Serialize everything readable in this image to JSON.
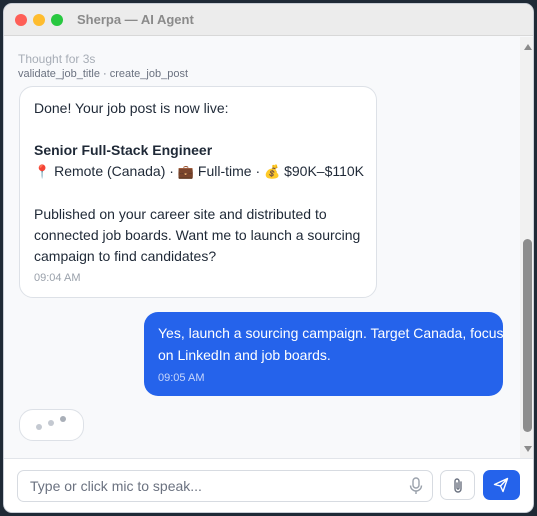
{
  "window": {
    "title": "Sherpa — AI Agent"
  },
  "chat": {
    "thought": "Thought for 3s",
    "tools": "validate_job_title · create_job_post",
    "agent_message": {
      "intro": "Done! Your job post is now live:",
      "job_title": "Senior Full-Stack Engineer",
      "meta": {
        "location_icon": "📍",
        "location": "Remote (Canada)",
        "type_icon": "💼",
        "type": "Full-time",
        "salary_icon": "💰",
        "salary": "$90K–$110K",
        "separator": "·"
      },
      "body_lines": [
        "Published on your career site and distributed to",
        "connected job boards. Want me to launch a sourcing",
        "campaign to find candidates?"
      ],
      "time": "09:04 AM"
    },
    "user_message": {
      "lines": [
        "Yes, launch a sourcing campaign. Target Canada, focus",
        "on LinkedIn and job boards."
      ],
      "time": "09:05 AM"
    }
  },
  "composer": {
    "placeholder": "Type or click mic to speak...",
    "value": ""
  },
  "icons": {
    "mic": "mic-icon",
    "attach": "paperclip-icon",
    "send": "send-icon"
  },
  "colors": {
    "accent": "#2563eb",
    "close": "#fe5f57",
    "minimize": "#febc2e",
    "maximize": "#28c840"
  }
}
